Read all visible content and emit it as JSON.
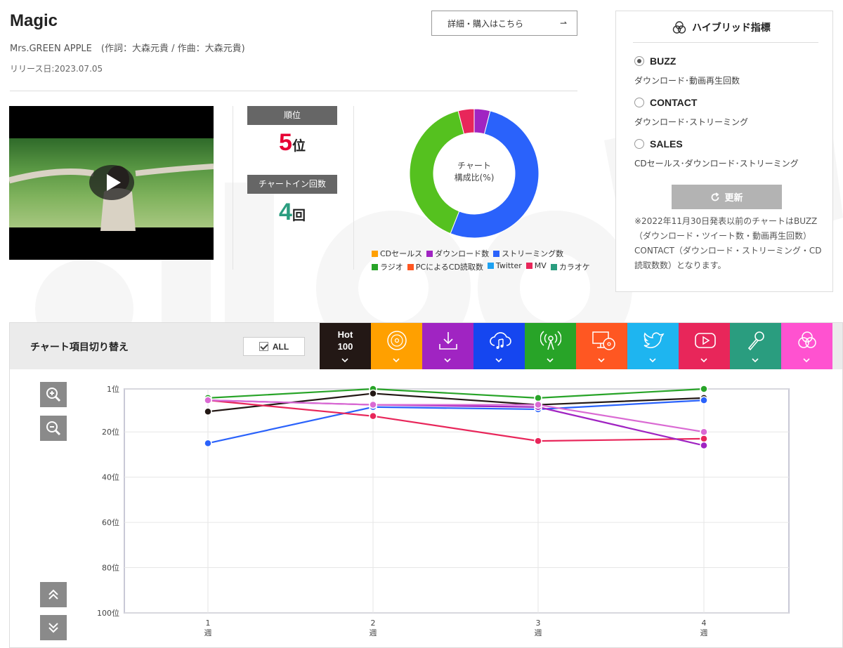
{
  "song": {
    "title": "Magic",
    "credit": "Mrs.GREEN APPLE　(作詞：大森元貴 / 作曲：大森元貴)",
    "release": "リリース日:2023.07.05"
  },
  "buy_button": {
    "label": "詳細・購入はこちら",
    "arrow": "⇀"
  },
  "video": {
    "play_icon": "play-icon"
  },
  "rank": {
    "rank_label": "順位",
    "rank_value": "5",
    "rank_unit": "位",
    "chartin_label": "チャートイン回数",
    "chartin_value": "4",
    "chartin_unit": "回",
    "rank_color": "#e60033",
    "chartin_color": "#2a9d7f"
  },
  "composition": {
    "center_line1": "チャート",
    "center_line2": "構成比(%)",
    "slices": [
      {
        "name": "ダウンロード数",
        "value": 4,
        "color": "#a024c2"
      },
      {
        "name": "ストリーミング数",
        "value": 52,
        "color": "#2a62fb"
      },
      {
        "name": "ラジオ",
        "value": 40,
        "color": "#55c11f"
      },
      {
        "name": "MV",
        "value": 4,
        "color": "#e8265a"
      }
    ],
    "legend_row1": [
      {
        "label": "CDセールス",
        "color": "#ffa000"
      },
      {
        "label": "ダウンロード数",
        "color": "#a024c2"
      },
      {
        "label": "ストリーミング数",
        "color": "#2a62fb"
      }
    ],
    "legend_row2": [
      {
        "label": "ラジオ",
        "color": "#28a428"
      },
      {
        "label": "PCによるCD読取数",
        "color": "#ff5722"
      },
      {
        "label": "Twitter",
        "color": "#1da1f2"
      },
      {
        "label": "MV",
        "color": "#e8265a"
      },
      {
        "label": "カラオケ",
        "color": "#2a9d7f"
      }
    ]
  },
  "hybrid": {
    "title": "ハイブリッド指標",
    "options": [
      {
        "label": "BUZZ",
        "desc": "ダウンロード･動画再生回数",
        "selected": true
      },
      {
        "label": "CONTACT",
        "desc": "ダウンロード･ストリーミング",
        "selected": false
      },
      {
        "label": "SALES",
        "desc": "CDセールス･ダウンロード･ストリーミング",
        "selected": false
      }
    ],
    "refresh_label": "更新",
    "note": "※2022年11月30日発表以前のチャートはBUZZ（ダウンロード・ツイート数・動画再生回数）CONTACT（ダウンロード・ストリーミング・CD読取数数）となります。"
  },
  "chart_switch": {
    "label": "チャート項目切り替え",
    "all_label": "ALL",
    "hot_line1": "Hot",
    "hot_line2": "100",
    "tabs": [
      {
        "name": "hot100",
        "icon": "hot100-text",
        "color": "#231815"
      },
      {
        "name": "cd-sales",
        "icon": "disc-icon",
        "color": "#ffa000"
      },
      {
        "name": "download",
        "icon": "download-icon",
        "color": "#a024c2"
      },
      {
        "name": "streaming",
        "icon": "cloud-music-icon",
        "color": "#1546f0"
      },
      {
        "name": "radio",
        "icon": "radio-tower-icon",
        "color": "#28a428"
      },
      {
        "name": "pc-cd-read",
        "icon": "pc-disc-icon",
        "color": "#ff5722"
      },
      {
        "name": "twitter",
        "icon": "twitter-icon",
        "color": "#1eb5f0"
      },
      {
        "name": "mv",
        "icon": "video-play-icon",
        "color": "#e8265a"
      },
      {
        "name": "karaoke",
        "icon": "microphone-icon",
        "color": "#2a9d7f"
      },
      {
        "name": "hybrid",
        "icon": "hybrid-icon",
        "color": "#ff52d0"
      }
    ]
  },
  "chart_data": {
    "type": "line",
    "x": [
      "1週",
      "2週",
      "3週",
      "4週"
    ],
    "y_ticks": [
      "1位",
      "20位",
      "40位",
      "60位",
      "80位",
      "100位"
    ],
    "y_tick_values": [
      1,
      20,
      40,
      60,
      80,
      100
    ],
    "ylim": [
      1,
      100
    ],
    "y_inverted": true,
    "grid": true,
    "series": [
      {
        "color": "#28a428",
        "values": [
          5,
          1,
          5,
          1
        ]
      },
      {
        "color": "#231815",
        "values": [
          11,
          3,
          8,
          5
        ]
      },
      {
        "color": "#2a62fb",
        "values": [
          25,
          9,
          10,
          6
        ]
      },
      {
        "color": "#e8265a",
        "values": [
          6,
          13,
          24,
          23
        ]
      },
      {
        "color": "#a024c2",
        "values": [
          6,
          8,
          9,
          26
        ]
      },
      {
        "color": "#da6ad3",
        "values": [
          6,
          8,
          8,
          20
        ]
      }
    ]
  }
}
